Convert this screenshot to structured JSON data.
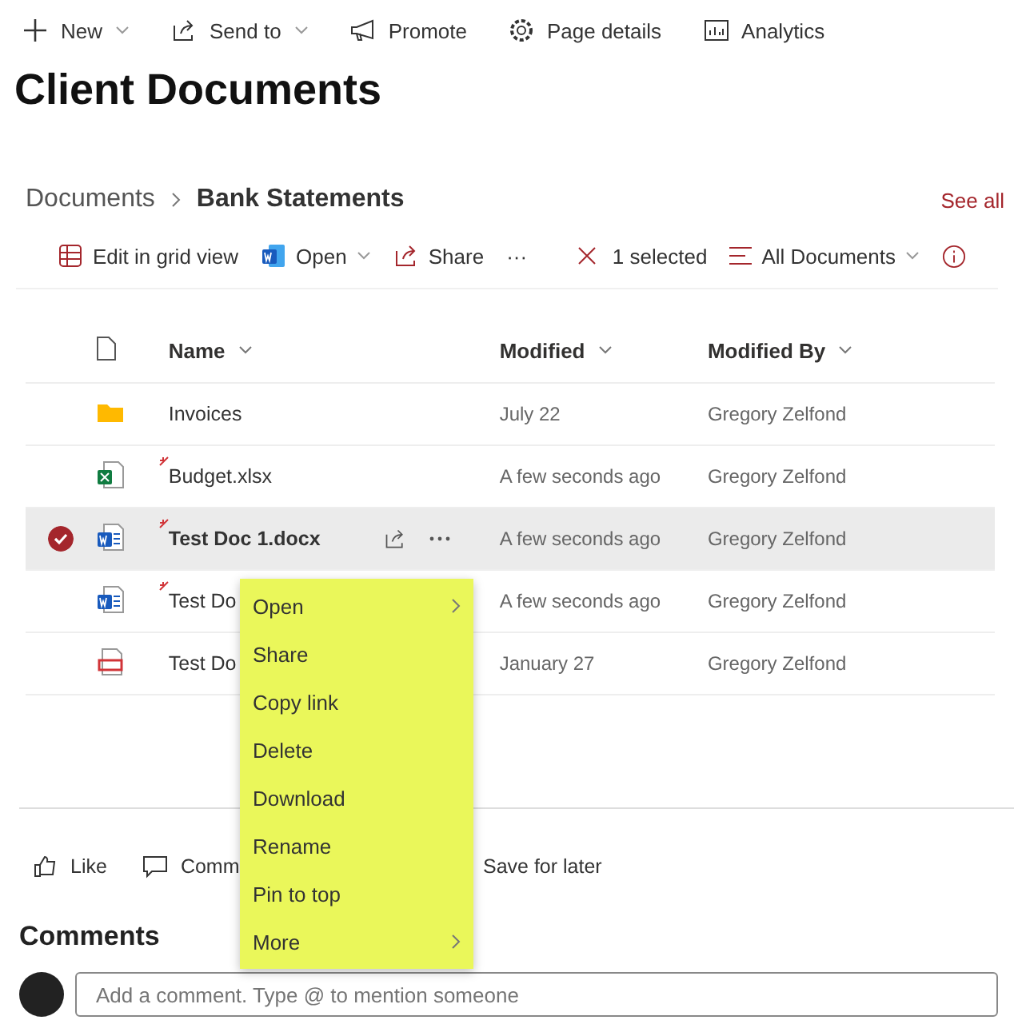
{
  "page_toolbar": [
    {
      "label": "New",
      "kind": "plus",
      "dropdown": true
    },
    {
      "label": "Send to",
      "kind": "send",
      "dropdown": true
    },
    {
      "label": "Promote",
      "kind": "megaphone",
      "dropdown": false
    },
    {
      "label": "Page details",
      "kind": "gear",
      "dropdown": false
    },
    {
      "label": "Analytics",
      "kind": "chart",
      "dropdown": false
    }
  ],
  "page_title": "Client Documents",
  "breadcrumb": {
    "parent": "Documents",
    "current": "Bank Statements",
    "see_all": "See all"
  },
  "command_bar": {
    "left": [
      {
        "label": "Edit in grid view",
        "kind": "grid",
        "dropdown": false
      },
      {
        "label": "Open",
        "kind": "word",
        "dropdown": true
      },
      {
        "label": "Share",
        "kind": "share",
        "dropdown": false
      },
      {
        "label": "···",
        "kind": "more",
        "dropdown": false
      }
    ],
    "selection": "1 selected",
    "view": "All Documents"
  },
  "table": {
    "columns": [
      "Name",
      "Modified",
      "Modified By"
    ],
    "rows": [
      {
        "kind": "folder",
        "name": "Invoices",
        "modified": "July 22",
        "modified_by": "Gregory Zelfond",
        "selected": false,
        "new": false
      },
      {
        "kind": "excel",
        "name": "Budget.xlsx",
        "modified": "A few seconds ago",
        "modified_by": "Gregory Zelfond",
        "selected": false,
        "new": true
      },
      {
        "kind": "word",
        "name": "Test Doc 1.docx",
        "modified": "A few seconds ago",
        "modified_by": "Gregory Zelfond",
        "selected": true,
        "new": true
      },
      {
        "kind": "word",
        "name": "Test Do",
        "modified": "A few seconds ago",
        "modified_by": "Gregory Zelfond",
        "selected": false,
        "new": true
      },
      {
        "kind": "pdf",
        "name": "Test Do",
        "modified": "January 27",
        "modified_by": "Gregory Zelfond",
        "selected": false,
        "new": false
      }
    ]
  },
  "context_menu": [
    {
      "label": "Open",
      "submenu": true
    },
    {
      "label": "Share",
      "submenu": false
    },
    {
      "label": "Copy link",
      "submenu": false
    },
    {
      "label": "Delete",
      "submenu": false
    },
    {
      "label": "Download",
      "submenu": false
    },
    {
      "label": "Rename",
      "submenu": false
    },
    {
      "label": "Pin to top",
      "submenu": false
    },
    {
      "label": "More",
      "submenu": true
    }
  ],
  "social_bar": [
    {
      "label": "Like",
      "kind": "like"
    },
    {
      "label": "Comm",
      "kind": "comment"
    },
    {
      "label": "Save for later",
      "kind": "none"
    }
  ],
  "comments": {
    "heading": "Comments",
    "placeholder": "Add a comment. Type @ to mention someone"
  }
}
